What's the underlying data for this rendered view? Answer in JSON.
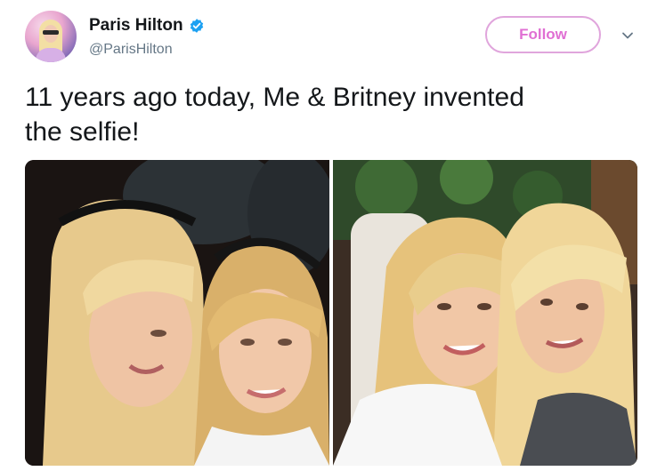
{
  "author": {
    "display_name": "Paris Hilton",
    "handle": "@ParisHilton",
    "verified": true,
    "avatar_icon": "profile-avatar"
  },
  "actions": {
    "follow_label": "Follow",
    "more_icon": "chevron-down-icon"
  },
  "tweet": {
    "text": "11 years ago today, Me & Britney invented\nthe selfie!"
  },
  "media": {
    "count": 2,
    "photos": [
      "selfie-photo-left",
      "selfie-photo-right"
    ]
  },
  "colors": {
    "follow_accent": "#e06fd3",
    "follow_border": "#e0a5dc",
    "verified_badge": "#1da1f2",
    "handle_gray": "#657786"
  }
}
